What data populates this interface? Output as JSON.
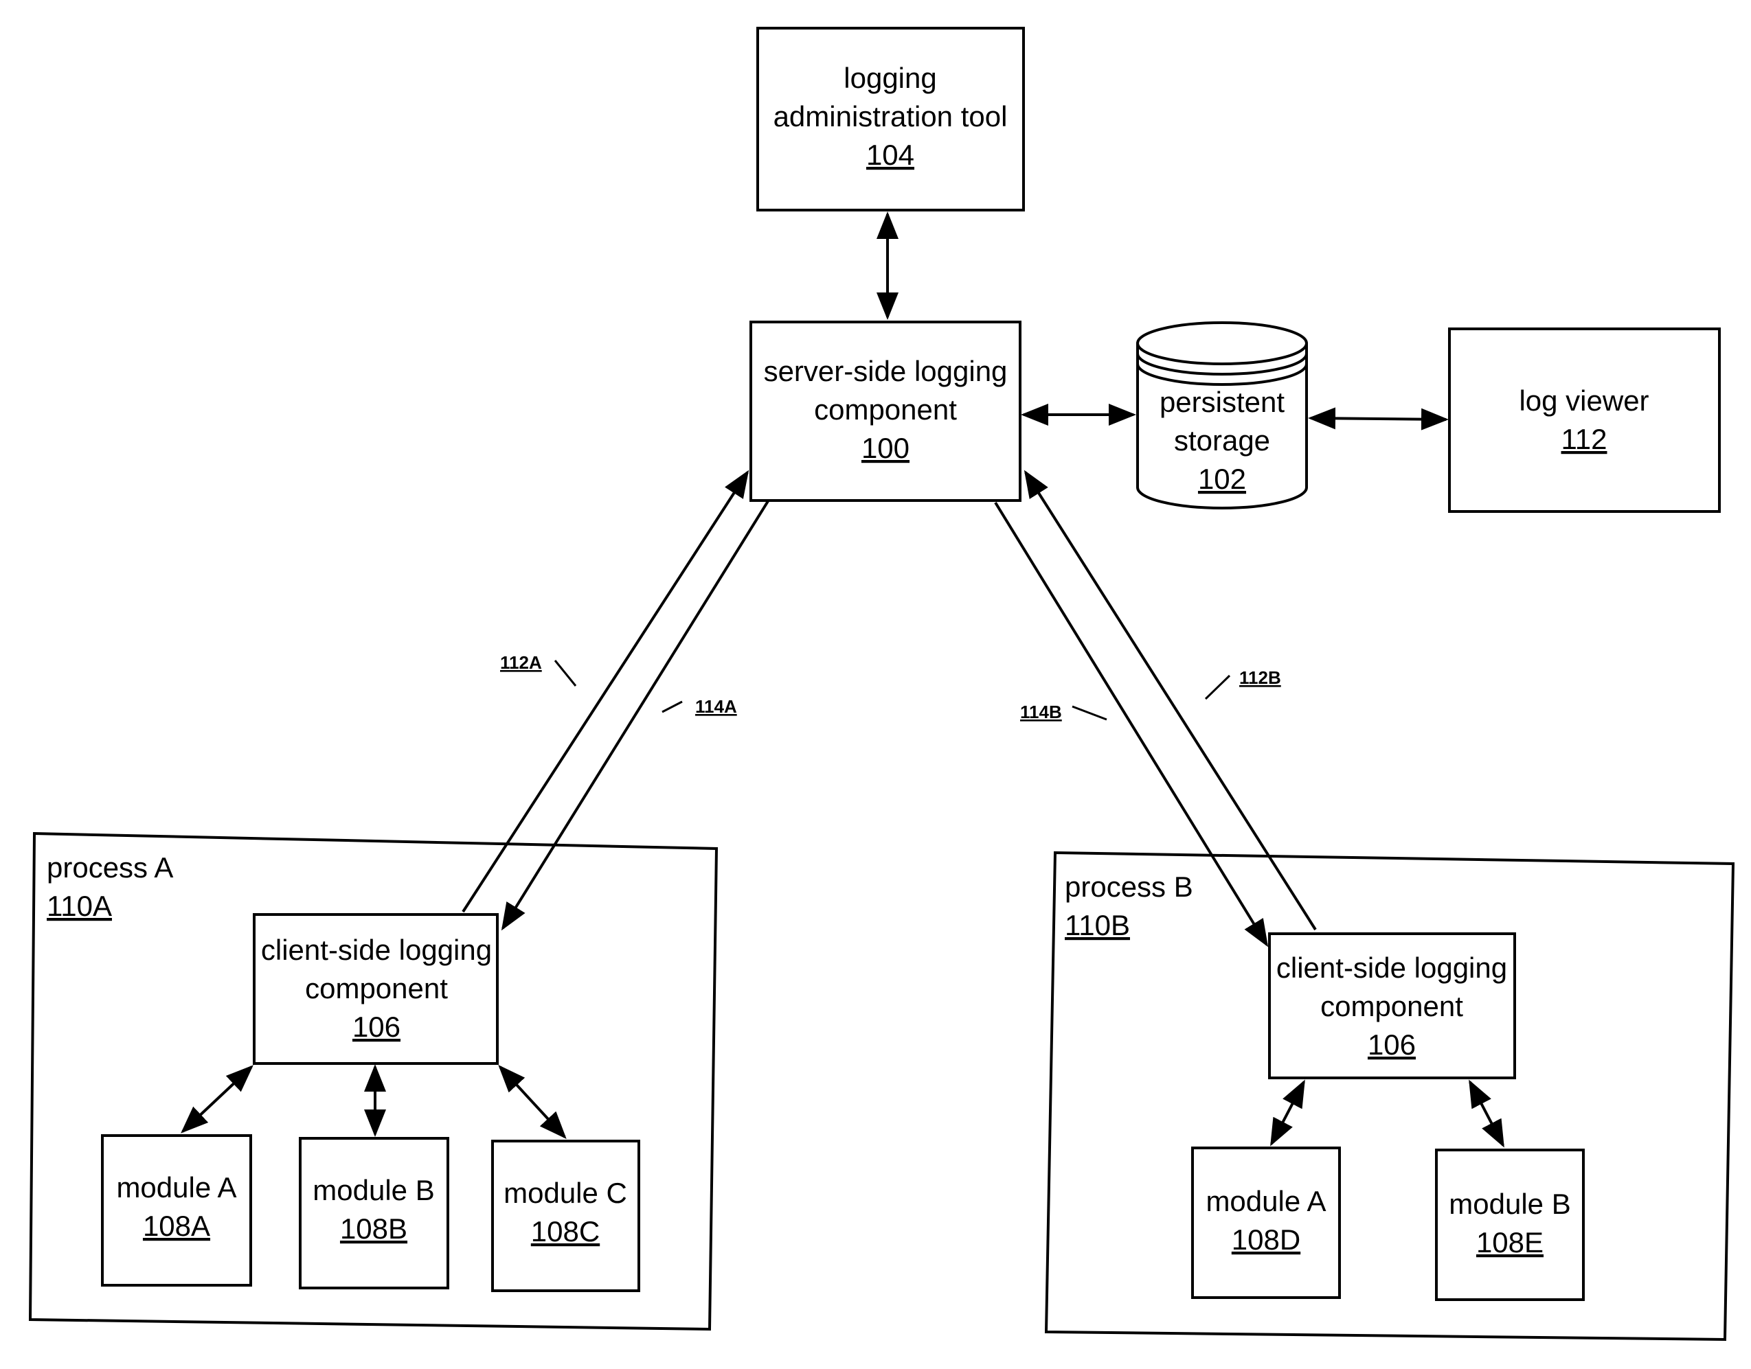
{
  "diagram": {
    "nodes": {
      "admin_tool": {
        "line1": "logging",
        "line2": "administration tool",
        "ref": "104"
      },
      "server": {
        "line1": "server-side logging",
        "line2": "component",
        "ref": "100"
      },
      "storage": {
        "line1": "persistent",
        "line2": "storage",
        "ref": "102"
      },
      "log_viewer": {
        "line1": "log viewer",
        "ref": "112"
      },
      "process_a": {
        "label": "process A",
        "ref": "110A"
      },
      "client_a": {
        "line1": "client-side logging",
        "line2": "component",
        "ref": "106"
      },
      "module_108a": {
        "label": "module A",
        "ref": "108A"
      },
      "module_108b": {
        "label": "module B",
        "ref": "108B"
      },
      "module_108c": {
        "label": "module C",
        "ref": "108C"
      },
      "process_b": {
        "label": "process B",
        "ref": "110B"
      },
      "client_b": {
        "line1": "client-side logging",
        "line2": "component",
        "ref": "106"
      },
      "module_108d": {
        "label": "module A",
        "ref": "108D"
      },
      "module_108e": {
        "label": "module B",
        "ref": "108E"
      }
    },
    "connection_labels": {
      "c112a": "112A",
      "c114a": "114A",
      "c114b": "114B",
      "c112b": "112B"
    },
    "edges": [
      {
        "from": "admin_tool",
        "to": "server",
        "type": "bidirectional"
      },
      {
        "from": "server",
        "to": "storage",
        "type": "bidirectional"
      },
      {
        "from": "storage",
        "to": "log_viewer",
        "type": "bidirectional"
      },
      {
        "from": "client_a",
        "to": "server",
        "type": "directed",
        "label": "112A"
      },
      {
        "from": "server",
        "to": "client_a",
        "type": "directed",
        "label": "114A"
      },
      {
        "from": "server",
        "to": "client_b",
        "type": "directed",
        "label": "114B"
      },
      {
        "from": "client_b",
        "to": "server",
        "type": "directed",
        "label": "112B"
      },
      {
        "from": "client_a",
        "to": "module_108a",
        "type": "bidirectional"
      },
      {
        "from": "client_a",
        "to": "module_108b",
        "type": "bidirectional"
      },
      {
        "from": "client_a",
        "to": "module_108c",
        "type": "bidirectional"
      },
      {
        "from": "client_b",
        "to": "module_108d",
        "type": "bidirectional"
      },
      {
        "from": "client_b",
        "to": "module_108e",
        "type": "bidirectional"
      }
    ]
  }
}
